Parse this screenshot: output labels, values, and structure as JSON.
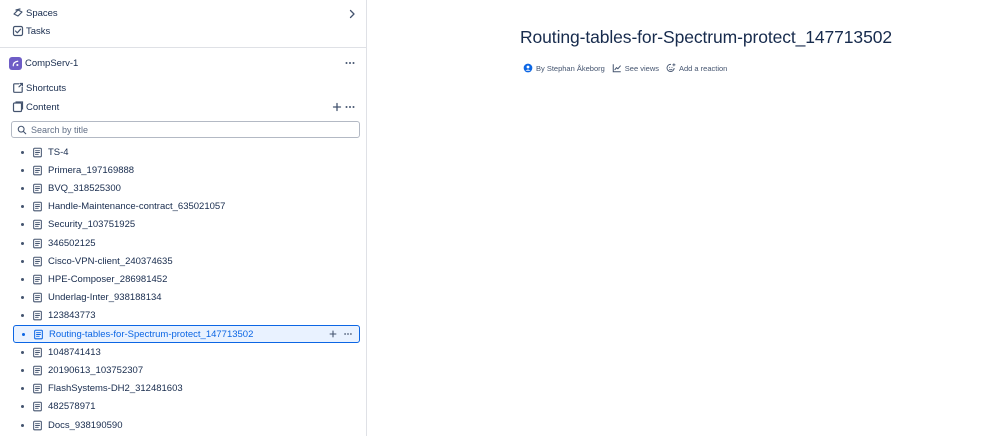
{
  "nav": {
    "spaces_label": "Spaces",
    "tasks_label": "Tasks"
  },
  "space": {
    "name": "CompServ-1",
    "shortcuts_label": "Shortcuts",
    "content_label": "Content"
  },
  "search": {
    "placeholder": "Search by title"
  },
  "tree": {
    "items": [
      {
        "label": "TS-4"
      },
      {
        "label": "Primera_197169888"
      },
      {
        "label": "BVQ_318525300"
      },
      {
        "label": "Handle-Maintenance-contract_635021057"
      },
      {
        "label": "Security_103751925"
      },
      {
        "label": "346502125"
      },
      {
        "label": "Cisco-VPN-client_240374635"
      },
      {
        "label": "HPE-Composer_286981452"
      },
      {
        "label": "Underlag-Inter_938188134"
      },
      {
        "label": "123843773"
      },
      {
        "label": "Routing-tables-for-Spectrum-protect_147713502",
        "selected": true
      },
      {
        "label": "1048741413"
      },
      {
        "label": "20190613_103752307"
      },
      {
        "label": "FlashSystems-DH2_312481603"
      },
      {
        "label": "482578971"
      },
      {
        "label": "Docs_938190590"
      }
    ]
  },
  "page": {
    "title": "Routing-tables-for-Spectrum-protect_147713502",
    "author": "By Stephan Åkeborg",
    "see_views": "See views",
    "add_reaction": "Add a reaction"
  },
  "colors": {
    "accent": "#0c66e4",
    "space_logo": "#6e5dc6",
    "text": "#172b4d",
    "subtle": "#44546f"
  }
}
